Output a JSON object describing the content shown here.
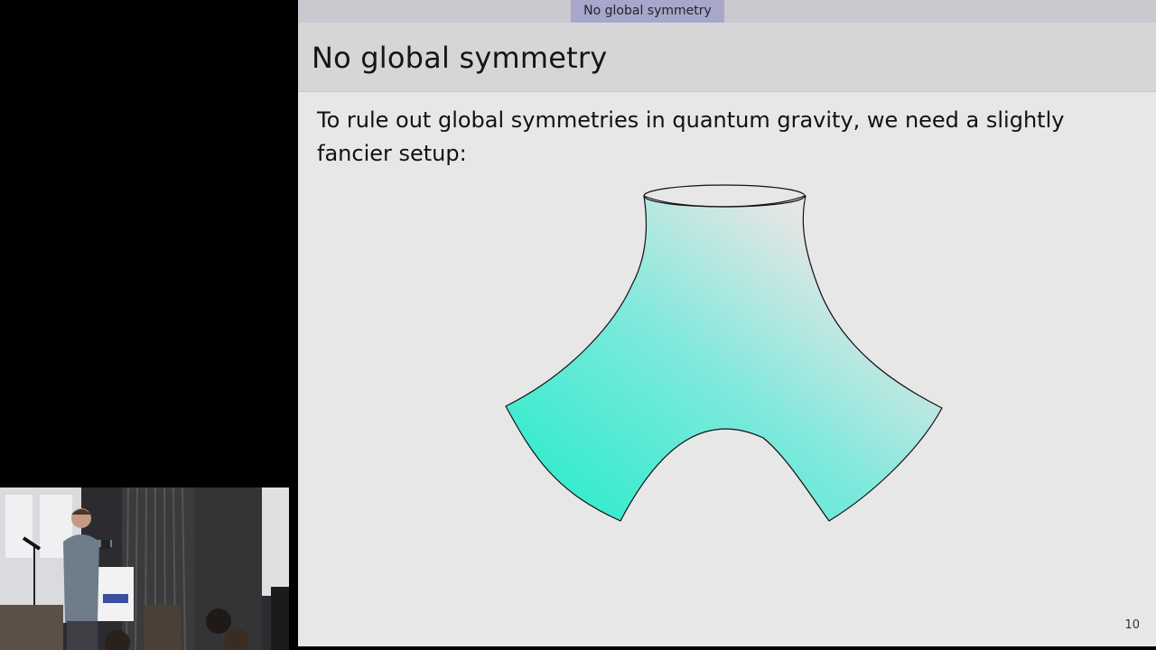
{
  "slide": {
    "nav_section": "No global symmetry",
    "title": "No global symmetry",
    "body_text": "To rule out global symmetries in quantum gravity, we need a slightly fancier setup:",
    "page_number": "10"
  },
  "diagram": {
    "description_icon": "pair-of-pants-surface",
    "fill_color_start": "#2ff0cc",
    "fill_color_end": "#e6e6e6",
    "outline_color": "#111111"
  },
  "video_inset": {
    "icon": "speaker-video-feed"
  }
}
